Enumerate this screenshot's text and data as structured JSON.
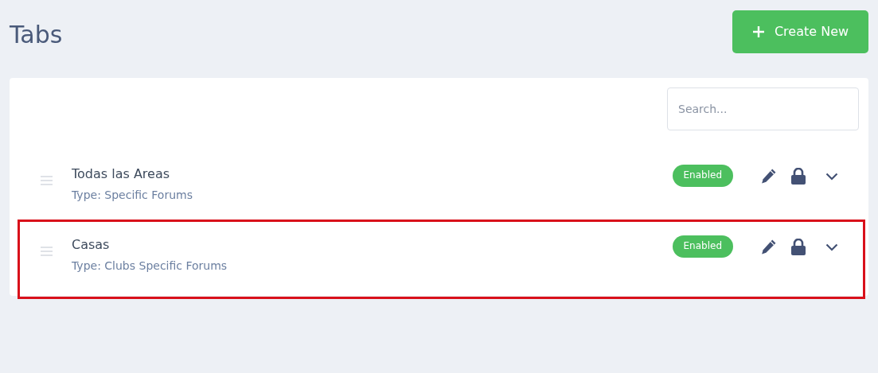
{
  "page": {
    "title": "Tabs",
    "create_button": "Create New"
  },
  "search": {
    "placeholder": "Search..."
  },
  "tabs": [
    {
      "name": "Todas las Areas",
      "type": "Type: Specific Forums",
      "status": "Enabled",
      "highlighted": false
    },
    {
      "name": "Casas",
      "type": "Type: Clubs Specific Forums",
      "status": "Enabled",
      "highlighted": true
    }
  ]
}
